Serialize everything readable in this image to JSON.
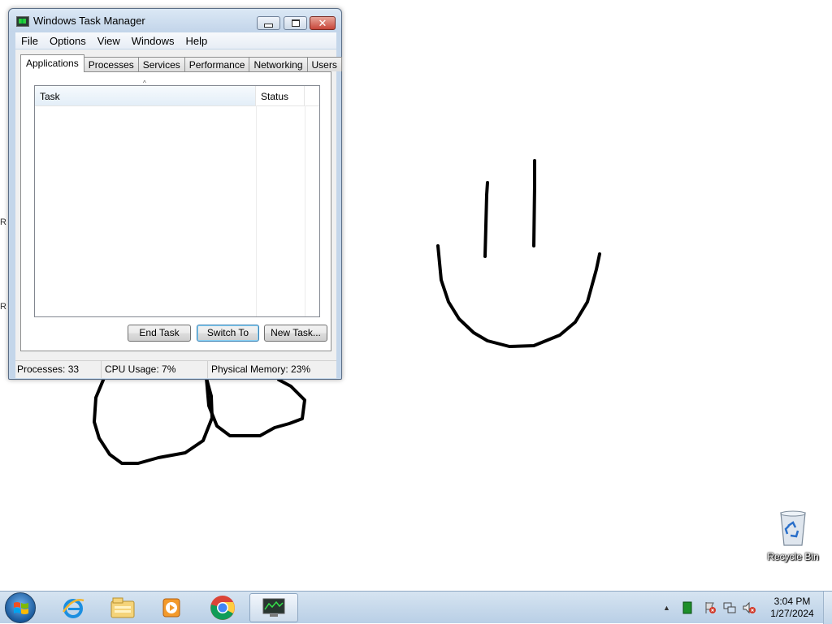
{
  "desktop": {
    "edge_glyph": "R",
    "recycle_bin_label": "Recycle Bin"
  },
  "window": {
    "title": "Windows Task Manager",
    "close_glyph": "✕",
    "menu": [
      "File",
      "Options",
      "View",
      "Windows",
      "Help"
    ],
    "tabs": [
      "Applications",
      "Processes",
      "Services",
      "Performance",
      "Networking",
      "Users"
    ],
    "active_tab": "Applications",
    "columns": {
      "task": "Task",
      "status": "Status"
    },
    "sort_glyph": "^",
    "buttons": {
      "end_task": "End Task",
      "switch_to": "Switch To",
      "new_task": "New Task..."
    },
    "status": {
      "processes": "Processes: 33",
      "cpu": "CPU Usage: 7%",
      "memory": "Physical Memory: 23%"
    }
  },
  "taskbar": {
    "pinned": [
      "start-orb",
      "internet-explorer-icon",
      "windows-explorer-icon",
      "media-player-icon",
      "chrome-icon",
      "task-manager-icon"
    ],
    "tray_arrow": "▲",
    "clock_time": "3:04 PM",
    "clock_date": "1/27/2024"
  },
  "colors": {
    "window_frame": "#c4d6ea",
    "close_button": "#c7463a",
    "taskbar": "#c6d8ec"
  }
}
